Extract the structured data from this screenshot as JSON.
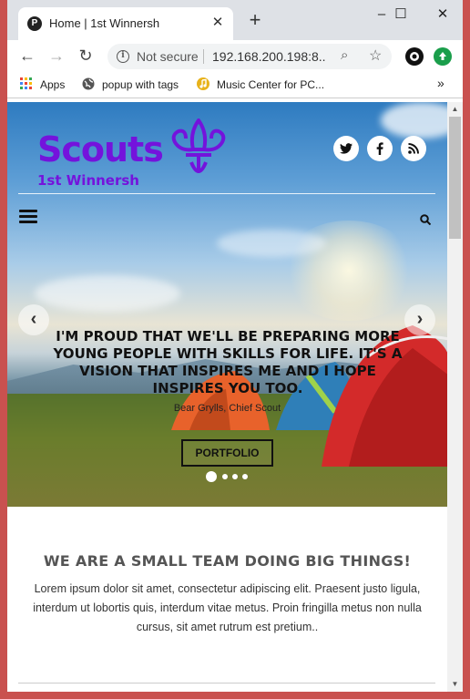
{
  "browser": {
    "tab_title": "Home | 1st Winnersh",
    "tab_favicon": "P",
    "new_tab": "+",
    "window_controls": {
      "minimize": "–",
      "maximize": "☐",
      "close": "✕"
    },
    "nav": {
      "back": "←",
      "forward": "→",
      "reload": "↻"
    },
    "address": {
      "security_label": "Not secure",
      "url": "192.168.200.198:8..."
    },
    "omnibox_icons": {
      "info": "i",
      "zoom": "⌕",
      "star": "☆"
    },
    "bookmarks": [
      {
        "label": "Apps",
        "icon": "apps-grid-icon"
      },
      {
        "label": "popup with tags",
        "icon": "globe-icon"
      },
      {
        "label": "Music Center for PC...",
        "icon": "music-icon"
      }
    ],
    "bookmarks_overflow": "»"
  },
  "site": {
    "logo_title": "Scouts",
    "logo_subtitle": "1st Winnersh",
    "brand_color": "#7413dc",
    "social": [
      {
        "name": "twitter",
        "glyph": "𝕥"
      },
      {
        "name": "facebook",
        "glyph": "f"
      },
      {
        "name": "rss",
        "glyph": "◉"
      }
    ]
  },
  "carousel": {
    "prev": "‹",
    "next": "›",
    "quote": "I'M PROUD THAT WE'LL BE PREPARING MORE YOUNG PEOPLE WITH SKILLS FOR LIFE. IT'S A VISION THAT INSPIRES ME AND I HOPE INSPIRES YOU TOO.",
    "author": "Bear Grylls, Chief Scout",
    "button": "PORTFOLIO",
    "slides": 4,
    "active_slide": 1
  },
  "section": {
    "title": "WE ARE A SMALL TEAM DOING BIG THINGS!",
    "body": "Lorem ipsum dolor sit amet, consectetur adipiscing elit. Praesent justo ligula, interdum ut lobortis quis, interdum vitae metus. Proin fringilla metus non nulla cursus, sit amet rutrum est pretium.."
  }
}
